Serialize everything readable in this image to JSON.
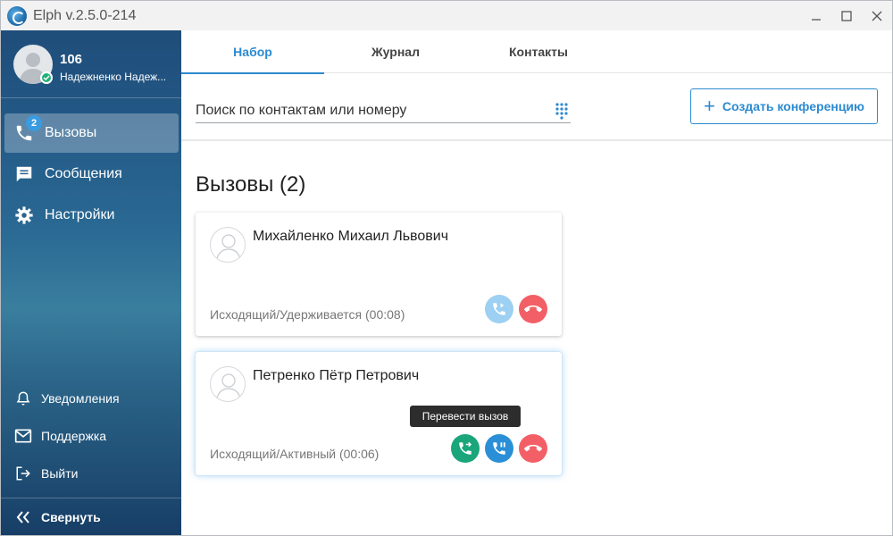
{
  "window": {
    "title": "Elph v.2.5.0-214",
    "controls": [
      "minimize",
      "maximize",
      "close"
    ]
  },
  "sidebar": {
    "profile": {
      "extension": "106",
      "name": "Надежненко Надеж...",
      "status": "online"
    },
    "nav": [
      {
        "label": "Вызовы",
        "icon": "phone-icon",
        "badge": "2",
        "active": true
      },
      {
        "label": "Сообщения",
        "icon": "chat-icon",
        "active": false
      },
      {
        "label": "Настройки",
        "icon": "gear-icon",
        "active": false
      }
    ],
    "bottom": [
      {
        "label": "Уведомления",
        "icon": "bell-icon"
      },
      {
        "label": "Поддержка",
        "icon": "mail-icon"
      },
      {
        "label": "Выйти",
        "icon": "logout-icon"
      }
    ],
    "collapse_label": "Свернуть"
  },
  "tabs": [
    {
      "label": "Набор",
      "active": true
    },
    {
      "label": "Журнал",
      "active": false
    },
    {
      "label": "Контакты",
      "active": false
    }
  ],
  "search": {
    "placeholder": "Поиск по контактам или номеру"
  },
  "conference_button": "Создать конференцию",
  "calls": {
    "title": "Вызовы (2)",
    "items": [
      {
        "name": "Михайленко Михаил Львович",
        "status": "Исходящий/Удерживается (00:08)",
        "actions": [
          "resume-call-icon",
          "hangup-icon"
        ]
      },
      {
        "name": "Петренко Пётр Петрович",
        "status": "Исходящий/Активный (00:06)",
        "actions": [
          "transfer-call-icon",
          "hold-call-icon",
          "hangup-icon"
        ]
      }
    ]
  },
  "tooltip": "Перевести вызов",
  "colors": {
    "accent": "#2b8ad0",
    "hangup": "#f25f66",
    "transfer": "#1aa57a",
    "hold": "#2a8fd6",
    "resume_disabled": "#9dd0f2",
    "online": "#22b07a"
  }
}
